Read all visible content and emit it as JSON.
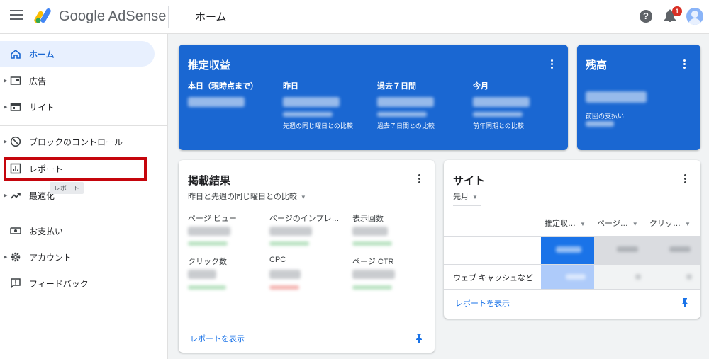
{
  "header": {
    "app_name": "Google AdSense",
    "page_title": "ホーム",
    "help_symbol": "?",
    "notification_count": "1"
  },
  "sidebar": {
    "items": [
      {
        "label": "ホーム",
        "icon": "home-icon",
        "active": true
      },
      {
        "label": "広告",
        "icon": "ads-icon"
      },
      {
        "label": "サイト",
        "icon": "sites-icon"
      },
      {
        "label": "ブロックのコントロール",
        "icon": "block-icon"
      },
      {
        "label": "レポート",
        "icon": "report-icon",
        "highlighted": true
      },
      {
        "label": "最適化",
        "icon": "trending-icon"
      },
      {
        "label": "お支払い",
        "icon": "payments-icon"
      },
      {
        "label": "アカウント",
        "icon": "gear-icon"
      },
      {
        "label": "フィードバック",
        "icon": "feedback-icon"
      }
    ],
    "tooltip": "レポート"
  },
  "estimated_earnings": {
    "title": "推定収益",
    "columns": [
      {
        "label": "本日（現時点まで）",
        "caption": ""
      },
      {
        "label": "昨日",
        "caption": "先週の同じ曜日との比較"
      },
      {
        "label": "過去７日間",
        "caption": "過去７日間との比較"
      },
      {
        "label": "今月",
        "caption": "前年同期との比較"
      }
    ]
  },
  "balance": {
    "title": "残高",
    "caption": "前回の支払い"
  },
  "performance": {
    "title": "掲載結果",
    "comparison": "昨日と先週の同じ曜日との比較",
    "metrics": [
      "ページ ビュー",
      "ページのインプレ…",
      "表示回数",
      "クリック数",
      "CPC",
      "ページ CTR"
    ],
    "link": "レポートを表示"
  },
  "sites": {
    "title": "サイト",
    "period": "先月",
    "headers": [
      "推定収…",
      "ページ…",
      "クリッ…"
    ],
    "row_label": "ウェブ キャッシュなど",
    "link": "レポートを表示"
  },
  "colors": {
    "brand_blue": "#1a67d2",
    "highlight_red": "#c5050c",
    "link_blue": "#1a73e8"
  }
}
